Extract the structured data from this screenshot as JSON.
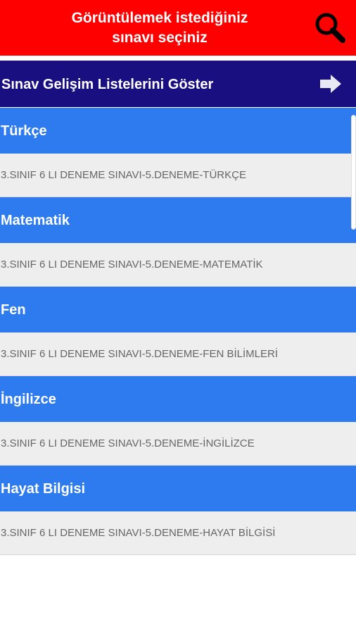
{
  "header": {
    "title": "Görüntülemek istediğiniz\nsınavı seçiniz",
    "search_icon": "search-icon"
  },
  "progress_bar": {
    "label": "Sınav Gelişim Listelerini Göster",
    "icon": "arrow-right-icon"
  },
  "subjects": [
    {
      "name": "Türkçe",
      "exam": "3.SINIF 6 LI DENEME SINAVI-5.DENEME-TÜRKÇE"
    },
    {
      "name": "Matematik",
      "exam": "3.SINIF 6 LI DENEME SINAVI-5.DENEME-MATEMATİK"
    },
    {
      "name": "Fen",
      "exam": "3.SINIF 6 LI DENEME SINAVI-5.DENEME-FEN BİLİMLERİ"
    },
    {
      "name": "İngilizce",
      "exam": "3.SINIF 6 LI DENEME SINAVI-5.DENEME-İNGİLİZCE"
    },
    {
      "name": "Hayat Bilgisi",
      "exam": "3.SINIF 6 LI DENEME SINAVI-5.DENEME-HAYAT BİLGİSİ"
    }
  ],
  "colors": {
    "header_bg": "#ff0000",
    "progress_bg": "#1a0f80",
    "subject_bg": "#2e7bf0",
    "item_bg": "#eeeeee",
    "item_text": "#666666"
  }
}
